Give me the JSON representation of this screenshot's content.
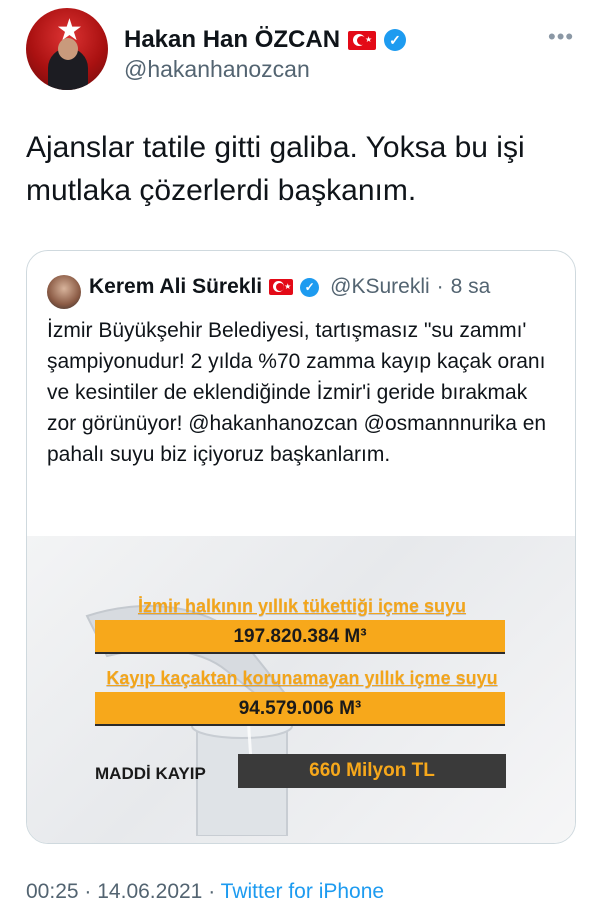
{
  "author": {
    "display_name": "Hakan Han ÖZCAN",
    "handle": "@hakanhanozcan",
    "flag_icon": "turkish-flag-icon",
    "verified_icon": "verified-badge-icon"
  },
  "tweet": {
    "text": "Ajanslar tatile gitti galiba. Yoksa bu işi mutlaka çözerlerdi başkanım."
  },
  "quoted": {
    "display_name": "Kerem Ali Sürekli",
    "handle": "@KSurekli",
    "separator": "·",
    "time": "8 sa",
    "text": "İzmir Büyükşehir Belediyesi, tartışmasız \"su zammı' şampiyonudur! 2 yılda %70 zamma kayıp kaçak oranı ve kesintiler de eklendiğinde İzmir'i geride bırakmak zor görünüyor! @hakanhanozcan @osmannnurika en pahalı suyu biz içiyoruz başkanlarım.",
    "image": {
      "row1_title": "İzmir halkının yıllık tükettiği içme suyu",
      "row1_value": "197.820.384 M³",
      "row2_title": "Kayıp kaçaktan korunamayan yıllık içme suyu",
      "row2_value": "94.579.006 M³",
      "loss_label": "MADDİ KAYIP",
      "loss_value": "660 Milyon TL",
      "accent_color": "#f7a81b"
    }
  },
  "footer": {
    "time": "00:25",
    "separator1": "·",
    "date": "14.06.2021",
    "separator2": "·",
    "source": "Twitter for iPhone"
  }
}
